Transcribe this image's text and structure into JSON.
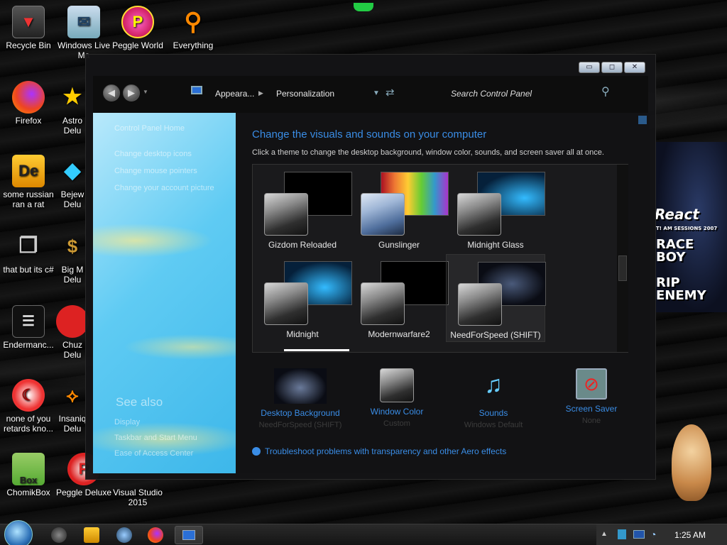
{
  "desktop": {
    "icons": [
      {
        "label": "Recycle Bin"
      },
      {
        "label": "Windows Live Ma"
      },
      {
        "label": "Peggle World"
      },
      {
        "label": "Everything"
      },
      {
        "label": "Firefox"
      },
      {
        "label": "Astro Delu"
      },
      {
        "label": "some russian ran a rat"
      },
      {
        "label": "Bejew Delu"
      },
      {
        "label": "that but its c#"
      },
      {
        "label": "Big M Delu"
      },
      {
        "label": "Endermanc..."
      },
      {
        "label": "Chuz Delu"
      },
      {
        "label": "none of you retards kno..."
      },
      {
        "label": "Insaniq Delu"
      },
      {
        "label": "ChomikBox"
      },
      {
        "label": "Peggle Deluxe"
      },
      {
        "label": "Visual Studio 2015"
      }
    ],
    "art_text": [
      "React",
      "T! AM SESSIONS 2007",
      "RACE BOY",
      "RIP ENEMY"
    ],
    "chomikbox_badge": "Box",
    "de_badge": "De"
  },
  "window": {
    "controls": {
      "minimize": "▭",
      "maximize": "◻",
      "close": "✕"
    },
    "nav": {
      "back": "◀",
      "forward": "▶"
    },
    "breadcrumb": [
      "Appeara...",
      "Personalization"
    ],
    "search_placeholder": "Search Control Panel",
    "left_pane": {
      "home_link": "Control Panel Home",
      "links": [
        "Change desktop icons",
        "Change mouse pointers",
        "Change your account picture"
      ],
      "see_also_title": "See also",
      "see_also_links": [
        "Display",
        "Taskbar and Start Menu",
        "Ease of Access Center"
      ]
    },
    "main": {
      "heading": "Change the visuals and sounds on your computer",
      "subheading": "Click a theme to change the desktop background, window color, sounds, and screen saver all at once.",
      "themes": [
        {
          "name": "Gizdom Reloaded"
        },
        {
          "name": "Gunslinger"
        },
        {
          "name": "Midnight Glass"
        },
        {
          "name": "Midnight"
        },
        {
          "name": "Modernwarfare2"
        },
        {
          "name": "NeedForSpeed (SHIFT)",
          "selected": true
        }
      ],
      "settings": [
        {
          "label": "Desktop Background",
          "value": "NeedForSpeed (SHIFT)"
        },
        {
          "label": "Window Color",
          "value": "Custom"
        },
        {
          "label": "Sounds",
          "value": "Windows Default"
        },
        {
          "label": "Screen Saver",
          "value": "None"
        }
      ],
      "troubleshoot_link": "Troubleshoot problems with transparency and other Aero effects"
    }
  },
  "taskbar": {
    "clock": "1:25 AM"
  }
}
